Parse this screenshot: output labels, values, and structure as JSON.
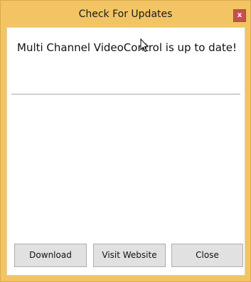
{
  "window": {
    "title": "Check For Updates",
    "close_glyph": "x"
  },
  "message": "Multi Channel VideoControl is up to date!",
  "buttons": {
    "download": "Download",
    "visit_website": "Visit Website",
    "close": "Close"
  },
  "colors": {
    "frame": "#f2c463",
    "close_button": "#c7504f",
    "button_face": "#e1e1e1"
  },
  "icons": {
    "cursor": "mouse-pointer-icon"
  }
}
